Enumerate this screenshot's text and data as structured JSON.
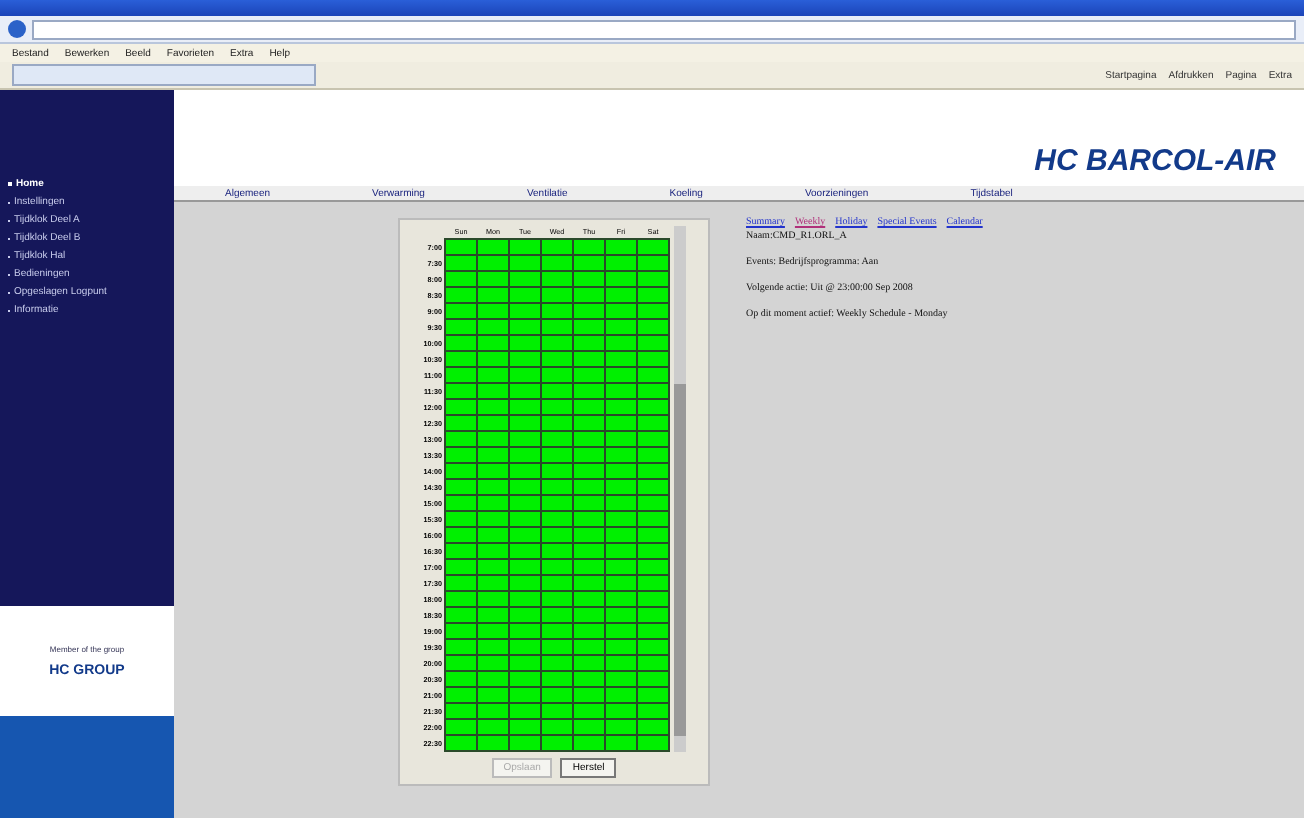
{
  "browser": {
    "menu": [
      "Bestand",
      "Bewerken",
      "Beeld",
      "Favorieten",
      "Extra",
      "Help"
    ],
    "toolbar": [
      "Startpagina",
      "Afdrukken",
      "Pagina",
      "Extra"
    ]
  },
  "sidebar": {
    "items": [
      {
        "label": "Home",
        "selected": true
      },
      {
        "label": "Instellingen",
        "selected": false
      },
      {
        "label": "Tijdklok Deel A",
        "selected": false
      },
      {
        "label": "Tijdklok Deel B",
        "selected": false
      },
      {
        "label": "Tijdklok Hal",
        "selected": false
      },
      {
        "label": "Bedieningen",
        "selected": false
      },
      {
        "label": "Opgeslagen Logpunt",
        "selected": false
      },
      {
        "label": "Informatie",
        "selected": false
      }
    ],
    "group_caption": "Member of the group",
    "group_logo": "HC GROUP"
  },
  "logo": "HC BARCOL-AIR",
  "nav": [
    "Algemeen",
    "Verwarming",
    "Ventilatie",
    "Koeling",
    "Voorzieningen",
    "Tijdstabel"
  ],
  "schedule": {
    "days": [
      "Sun",
      "Mon",
      "Tue",
      "Wed",
      "Thu",
      "Fri",
      "Sat"
    ],
    "rows": [
      {
        "time": "7:00",
        "on": [
          true,
          true,
          true,
          true,
          true,
          true,
          true
        ]
      },
      {
        "time": "7:30",
        "on": [
          true,
          true,
          true,
          true,
          true,
          true,
          true
        ]
      },
      {
        "time": "8:00",
        "on": [
          true,
          true,
          true,
          true,
          true,
          true,
          true
        ]
      },
      {
        "time": "8:30",
        "on": [
          true,
          true,
          true,
          true,
          true,
          true,
          true
        ]
      },
      {
        "time": "9:00",
        "on": [
          true,
          true,
          true,
          true,
          true,
          true,
          true
        ]
      },
      {
        "time": "9:30",
        "on": [
          true,
          true,
          true,
          true,
          true,
          true,
          true
        ]
      },
      {
        "time": "10:00",
        "on": [
          true,
          true,
          true,
          true,
          true,
          true,
          true
        ]
      },
      {
        "time": "10:30",
        "on": [
          true,
          true,
          true,
          true,
          true,
          true,
          true
        ]
      },
      {
        "time": "11:00",
        "on": [
          true,
          true,
          true,
          true,
          true,
          true,
          true
        ]
      },
      {
        "time": "11:30",
        "on": [
          true,
          true,
          true,
          true,
          true,
          true,
          true
        ]
      },
      {
        "time": "12:00",
        "on": [
          true,
          true,
          true,
          true,
          true,
          true,
          true
        ]
      },
      {
        "time": "12:30",
        "on": [
          true,
          true,
          true,
          true,
          true,
          true,
          true
        ]
      },
      {
        "time": "13:00",
        "on": [
          true,
          true,
          true,
          true,
          true,
          true,
          true
        ]
      },
      {
        "time": "13:30",
        "on": [
          true,
          true,
          true,
          true,
          true,
          true,
          true
        ]
      },
      {
        "time": "14:00",
        "on": [
          true,
          true,
          true,
          true,
          true,
          true,
          true
        ]
      },
      {
        "time": "14:30",
        "on": [
          true,
          true,
          true,
          true,
          true,
          true,
          true
        ]
      },
      {
        "time": "15:00",
        "on": [
          true,
          true,
          true,
          true,
          true,
          true,
          true
        ]
      },
      {
        "time": "15:30",
        "on": [
          true,
          true,
          true,
          true,
          true,
          true,
          true
        ]
      },
      {
        "time": "16:00",
        "on": [
          true,
          true,
          true,
          true,
          true,
          true,
          true
        ]
      },
      {
        "time": "16:30",
        "on": [
          true,
          true,
          true,
          true,
          true,
          true,
          true
        ]
      },
      {
        "time": "17:00",
        "on": [
          true,
          true,
          true,
          true,
          true,
          true,
          true
        ]
      },
      {
        "time": "17:30",
        "on": [
          true,
          true,
          true,
          true,
          true,
          true,
          true
        ]
      },
      {
        "time": "18:00",
        "on": [
          true,
          true,
          true,
          true,
          true,
          true,
          true
        ]
      },
      {
        "time": "18:30",
        "on": [
          true,
          true,
          true,
          true,
          true,
          true,
          true
        ]
      },
      {
        "time": "19:00",
        "on": [
          true,
          true,
          true,
          true,
          true,
          true,
          true
        ]
      },
      {
        "time": "19:30",
        "on": [
          true,
          true,
          true,
          true,
          true,
          true,
          true
        ]
      },
      {
        "time": "20:00",
        "on": [
          true,
          true,
          true,
          true,
          true,
          true,
          true
        ]
      },
      {
        "time": "20:30",
        "on": [
          true,
          true,
          true,
          true,
          true,
          true,
          true
        ]
      },
      {
        "time": "21:00",
        "on": [
          true,
          true,
          true,
          true,
          true,
          true,
          true
        ]
      },
      {
        "time": "21:30",
        "on": [
          true,
          true,
          true,
          true,
          true,
          true,
          true
        ]
      },
      {
        "time": "22:00",
        "on": [
          true,
          true,
          true,
          true,
          true,
          true,
          true
        ]
      },
      {
        "time": "22:30",
        "on": [
          true,
          true,
          true,
          true,
          true,
          true,
          true
        ]
      }
    ],
    "buttons": [
      {
        "label": "Opslaan",
        "disabled": true
      },
      {
        "label": "Herstel",
        "disabled": false
      }
    ]
  },
  "views": [
    {
      "label": "Summary",
      "selected": false
    },
    {
      "label": "Weekly",
      "selected": true
    },
    {
      "label": "Holiday",
      "selected": false
    },
    {
      "label": "Special Events",
      "selected": false
    },
    {
      "label": "Calendar",
      "selected": false
    }
  ],
  "name": "Naam:CMD_R1.ORL_A",
  "info": [
    "Events: Bedrijfsprogramma: Aan",
    "Volgende actie: Uit @ 23:00:00 Sep 2008",
    "Op dit moment actief: Weekly Schedule - Monday"
  ]
}
